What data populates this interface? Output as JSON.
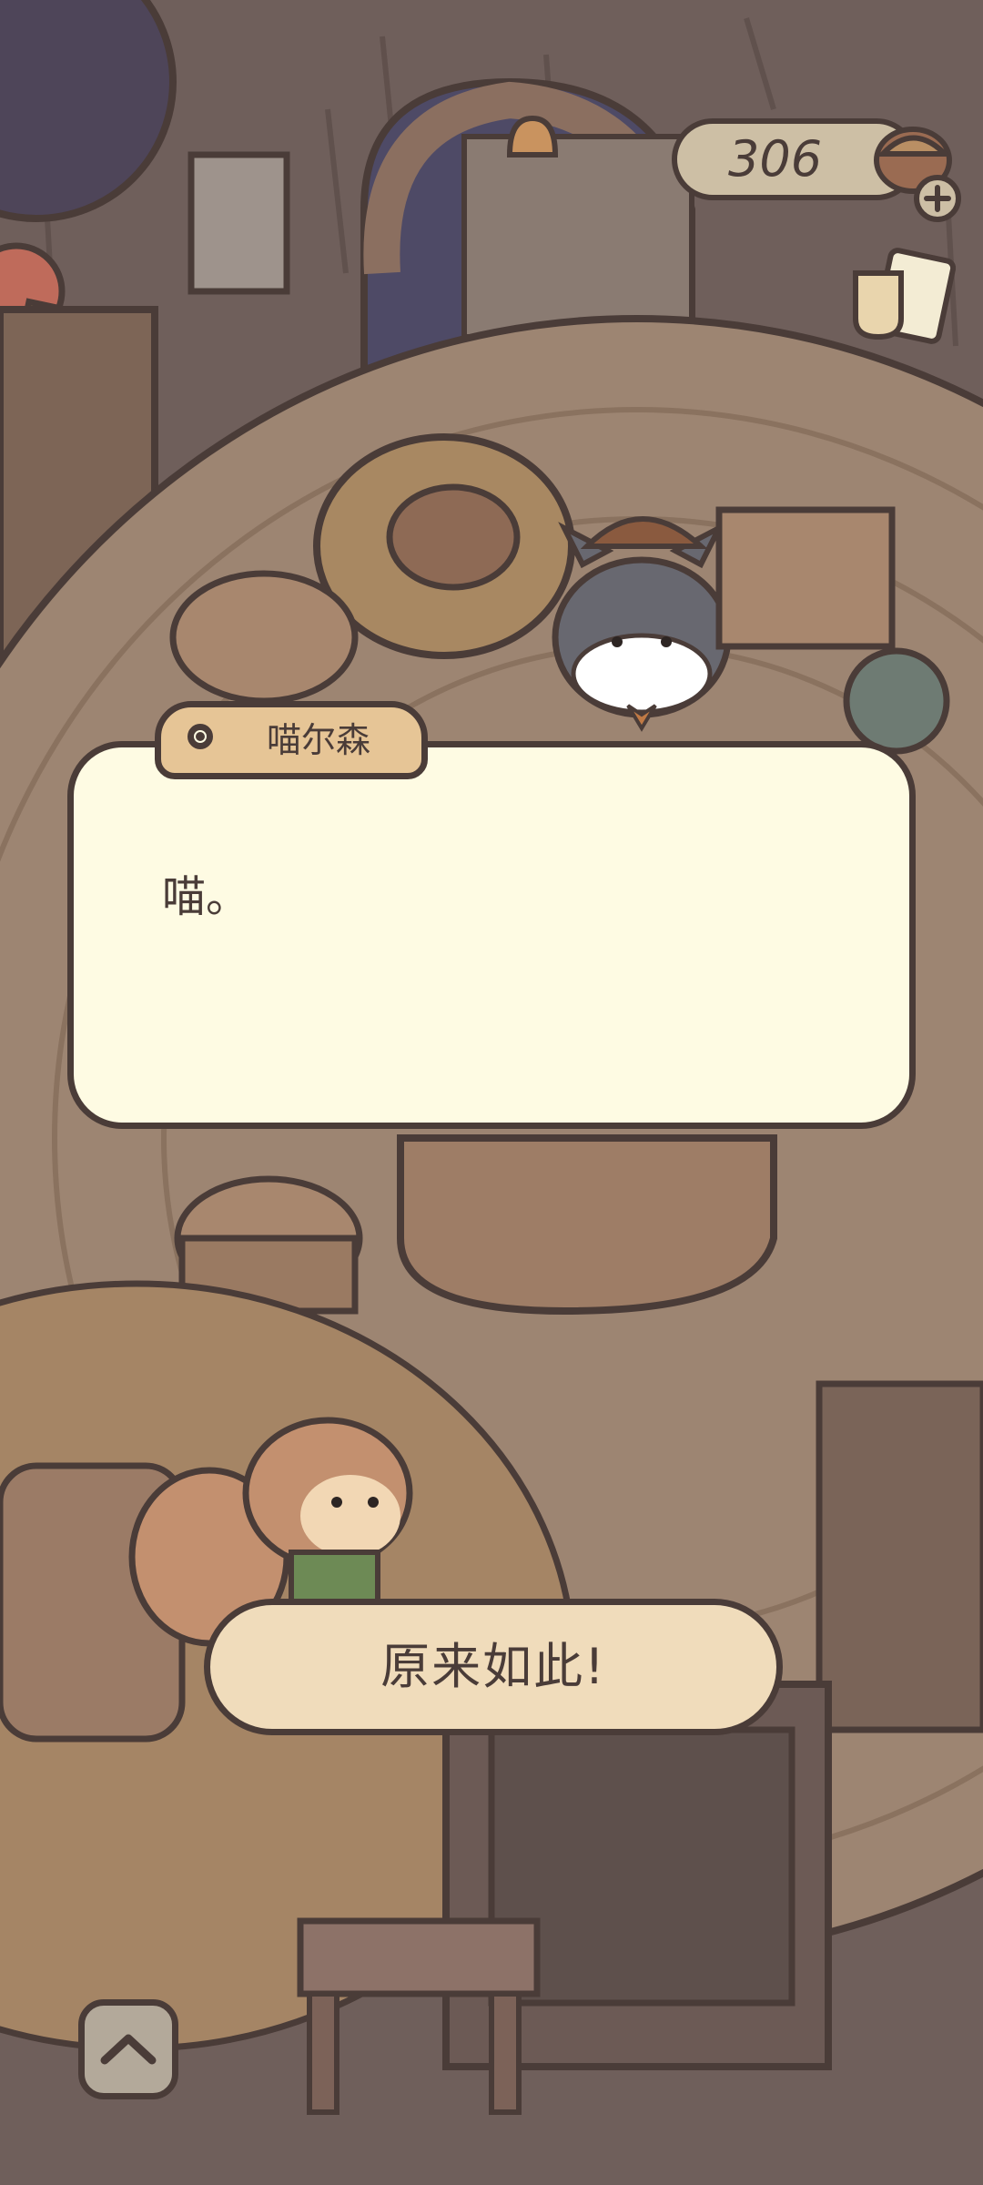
{
  "hud": {
    "coin_count": "306",
    "add_coin_icon": "plus-icon",
    "coin_icon": "acorn-icon",
    "side_icon": "cup-and-ticket-icon"
  },
  "dialog": {
    "speaker_name": "喵尔森",
    "speaker_dot_icon": "speaker-dot-icon",
    "text": "喵。"
  },
  "reply": {
    "label": "原来如此!"
  },
  "controls": {
    "collapse_icon": "chevron-up-icon"
  },
  "colors": {
    "outline": "#4a3c38",
    "dialog_bg": "#fefbe3",
    "name_tab_bg": "#e6c596",
    "reply_bg": "#f0dcbb",
    "floor": "#9d8572"
  }
}
